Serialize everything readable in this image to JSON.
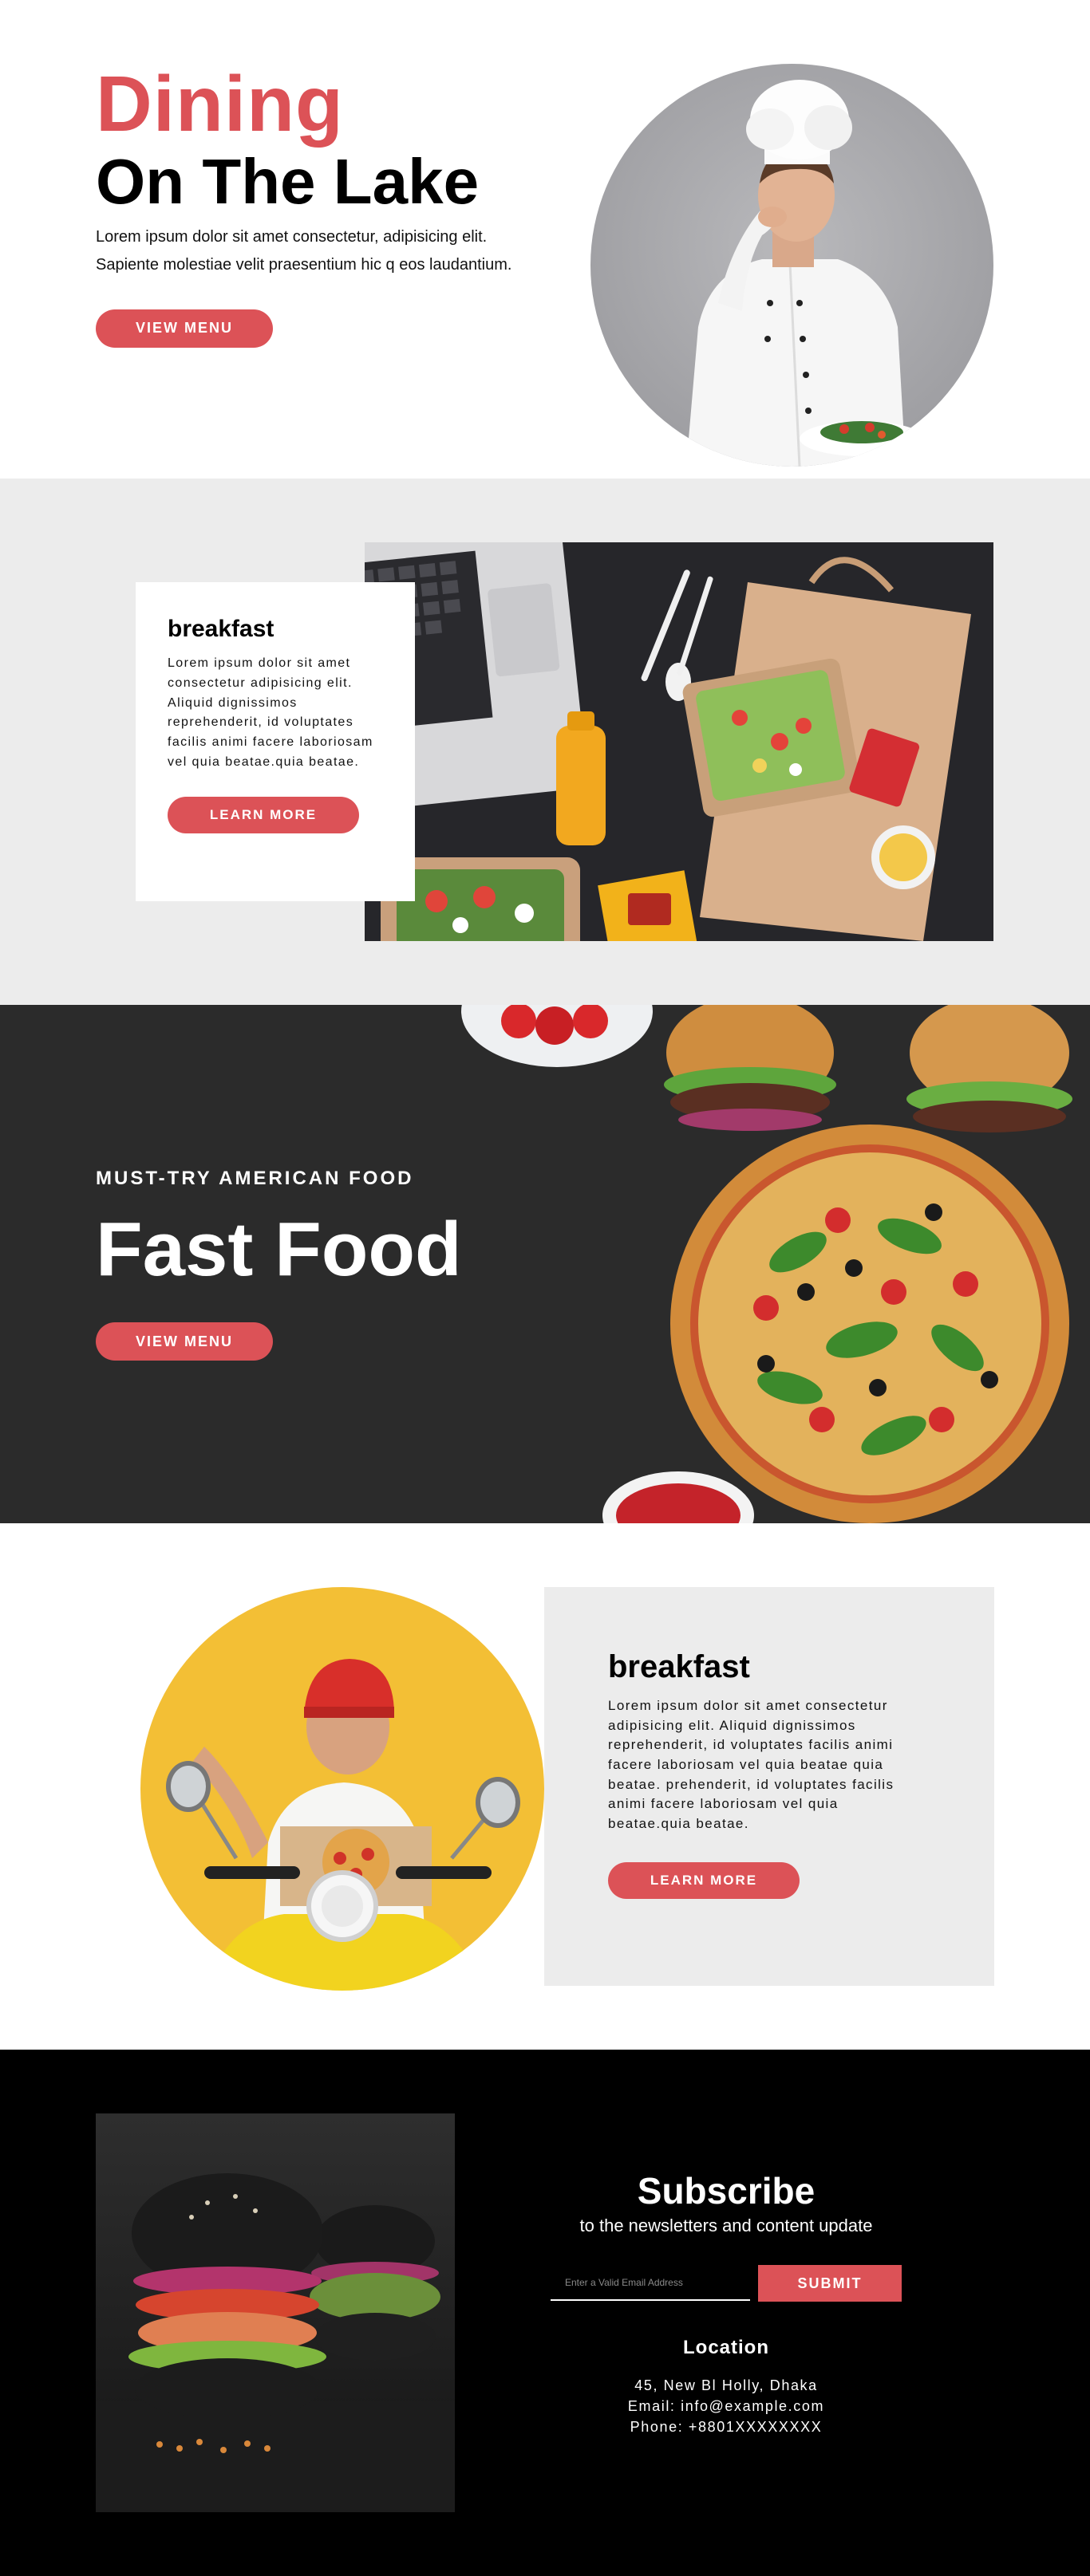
{
  "colors": {
    "accent": "#dc5257",
    "light_gray": "#ececec",
    "dark": "#2b2b2b",
    "black": "#000000"
  },
  "hero": {
    "title_line1": "Dining",
    "title_line2": "On The Lake",
    "description": "Lorem ipsum dolor sit amet consectetur, adipisicing elit. Sapiente molestiae velit praesentium hic q eos laudantium.",
    "button_label": "VIEW MENU",
    "image": "chef-kissing-fingers-photo"
  },
  "breakfast_one": {
    "title": "breakfast",
    "body": "Lorem ipsum dolor sit amet consectetur adipisicing elit. Aliquid dignissimos reprehenderit, id voluptates facilis animi facere laboriosam vel quia beatae.quia beatae.",
    "button_label": "LEARN MORE",
    "image": "takeaway-salad-laptop-photo"
  },
  "fast_food": {
    "subtitle": "MUST-TRY AMERICAN FOOD",
    "title": "Fast Food",
    "button_label": "VIEW MENU",
    "image": "pizza-burgers-photo"
  },
  "breakfast_two": {
    "title": "breakfast",
    "body": "Lorem ipsum dolor sit amet consectetur adipisicing elit. Aliquid dignissimos reprehenderit, id voluptates facilis animi facere laboriosam vel quia beatae quia beatae. prehenderit, id voluptates facilis animi facere laboriosam vel quia beatae.quia beatae.",
    "button_label": "LEARN MORE",
    "image": "pizza-delivery-scooter-photo"
  },
  "footer": {
    "image": "black-burgers-photo",
    "subscribe_title": "Subscribe",
    "subscribe_caption": "to the newsletters and content update",
    "email_placeholder": "Enter a Valid Email Address",
    "email_value": "",
    "submit_label": "SUBMIT",
    "location_title": "Location",
    "address": "45, New Bl Holly, Dhaka",
    "email": "Email: info@example.com",
    "phone": "Phone: +8801XXXXXXXX"
  }
}
